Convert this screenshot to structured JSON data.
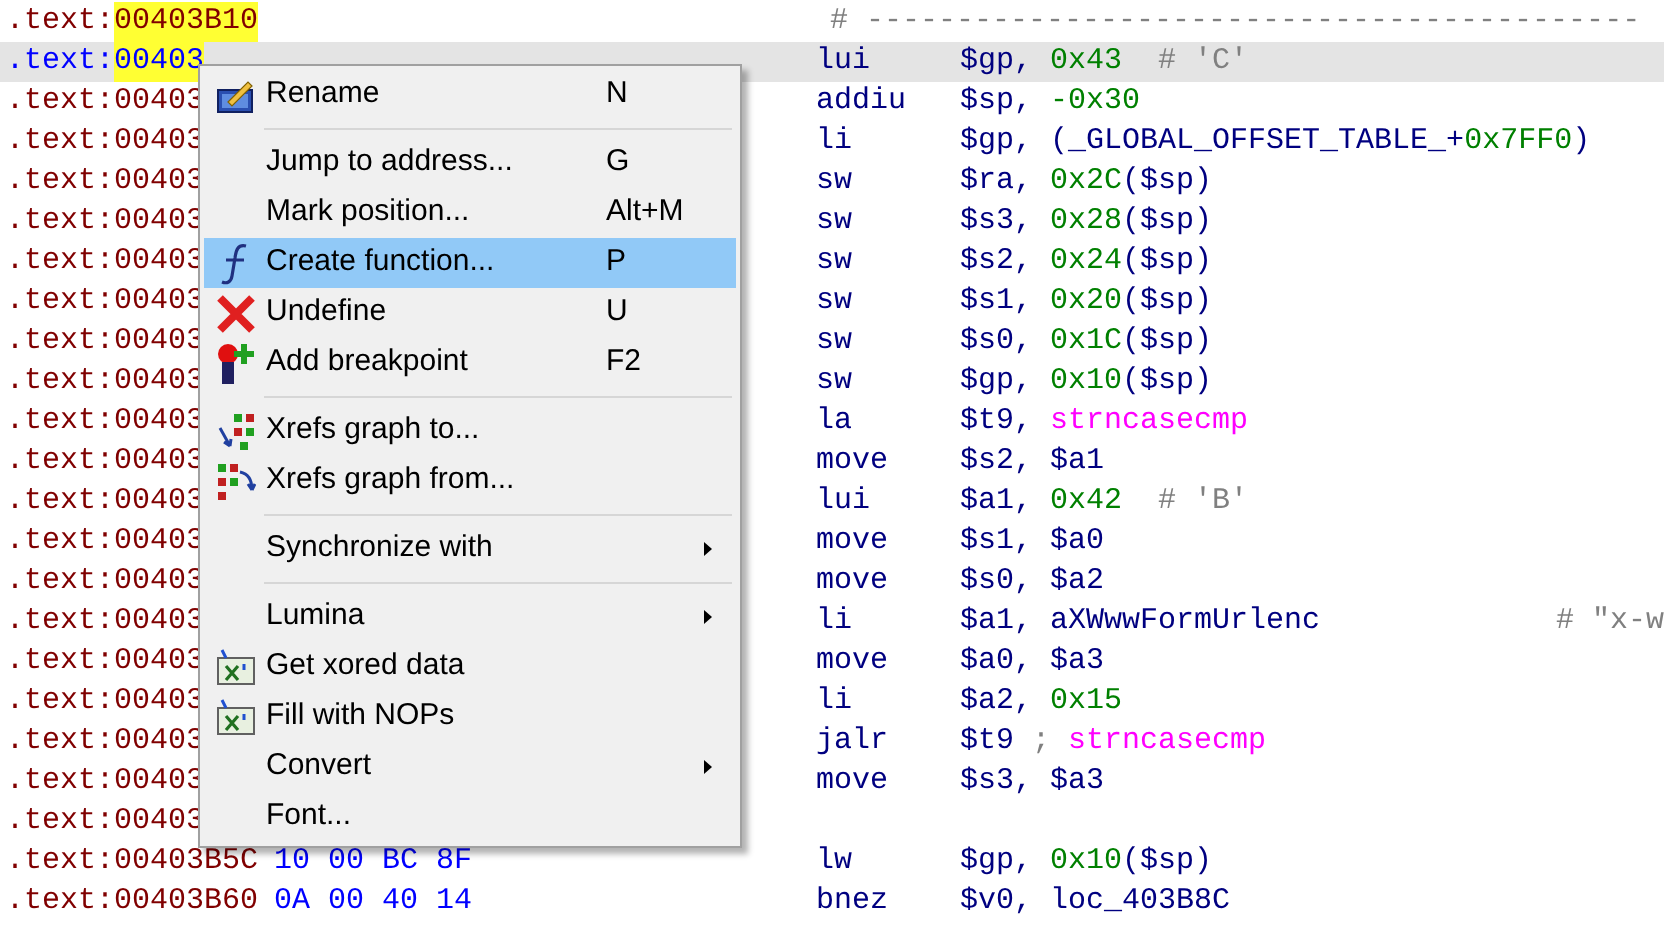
{
  "listing": {
    "rows": [
      {
        "segment": ".text:",
        "address": "00403B10",
        "highlighted": true,
        "selected": false,
        "tokens": [
          {
            "kind": "comment",
            "text": "# -------------------------------------------"
          }
        ]
      },
      {
        "segment": ".text:",
        "address": "00403",
        "highlighted": true,
        "selected": true,
        "mnemonic": "lui",
        "tokens": [
          {
            "kind": "reg",
            "text": "$gp,"
          },
          {
            "kind": "num",
            "text": "0x43"
          },
          {
            "kind": "comment",
            "text": " # 'C'"
          }
        ]
      },
      {
        "segment": ".text:",
        "address": "00403",
        "highlighted": false,
        "selected": false,
        "mnemonic": "addiu",
        "tokens": [
          {
            "kind": "reg",
            "text": "$sp,"
          },
          {
            "kind": "num",
            "text": "-0x30"
          }
        ]
      },
      {
        "segment": ".text:",
        "address": "00403",
        "highlighted": false,
        "selected": false,
        "mnemonic": "li",
        "tokens": [
          {
            "kind": "reg",
            "text": "$gp,"
          },
          {
            "kind": "reg",
            "text": "(_GLOBAL_OFFSET_TABLE_+"
          },
          {
            "kind": "num",
            "text": "0x7FF0"
          },
          {
            "kind": "punct",
            "text": ")"
          }
        ]
      },
      {
        "segment": ".text:",
        "address": "00403",
        "highlighted": false,
        "selected": false,
        "mnemonic": "sw",
        "tokens": [
          {
            "kind": "reg",
            "text": "$ra,"
          },
          {
            "kind": "num",
            "text": "0x2C"
          },
          {
            "kind": "punct",
            "text": "($sp)"
          }
        ]
      },
      {
        "segment": ".text:",
        "address": "00403",
        "highlighted": false,
        "selected": false,
        "mnemonic": "sw",
        "tokens": [
          {
            "kind": "reg",
            "text": "$s3,"
          },
          {
            "kind": "num",
            "text": "0x28"
          },
          {
            "kind": "punct",
            "text": "($sp)"
          }
        ]
      },
      {
        "segment": ".text:",
        "address": "00403",
        "highlighted": false,
        "selected": false,
        "mnemonic": "sw",
        "tokens": [
          {
            "kind": "reg",
            "text": "$s2,"
          },
          {
            "kind": "num",
            "text": "0x24"
          },
          {
            "kind": "punct",
            "text": "($sp)"
          }
        ]
      },
      {
        "segment": ".text:",
        "address": "00403",
        "highlighted": false,
        "selected": false,
        "mnemonic": "sw",
        "tokens": [
          {
            "kind": "reg",
            "text": "$s1,"
          },
          {
            "kind": "num",
            "text": "0x20"
          },
          {
            "kind": "punct",
            "text": "($sp)"
          }
        ]
      },
      {
        "segment": ".text:",
        "address": "00403",
        "highlighted": false,
        "selected": false,
        "mnemonic": "sw",
        "tokens": [
          {
            "kind": "reg",
            "text": "$s0,"
          },
          {
            "kind": "num",
            "text": "0x1C"
          },
          {
            "kind": "punct",
            "text": "($sp)"
          }
        ]
      },
      {
        "segment": ".text:",
        "address": "00403",
        "highlighted": false,
        "selected": false,
        "mnemonic": "sw",
        "tokens": [
          {
            "kind": "reg",
            "text": "$gp,"
          },
          {
            "kind": "num",
            "text": "0x10"
          },
          {
            "kind": "punct",
            "text": "($sp)"
          }
        ]
      },
      {
        "segment": ".text:",
        "address": "00403",
        "highlighted": false,
        "selected": false,
        "mnemonic": "la",
        "tokens": [
          {
            "kind": "reg",
            "text": "$t9,"
          },
          {
            "kind": "name",
            "text": "strncasecmp"
          }
        ]
      },
      {
        "segment": ".text:",
        "address": "00403",
        "highlighted": false,
        "selected": false,
        "mnemonic": "move",
        "tokens": [
          {
            "kind": "reg",
            "text": "$s2,"
          },
          {
            "kind": "reg",
            "text": "$a1"
          }
        ]
      },
      {
        "segment": ".text:",
        "address": "00403",
        "highlighted": false,
        "selected": false,
        "mnemonic": "lui",
        "tokens": [
          {
            "kind": "reg",
            "text": "$a1,"
          },
          {
            "kind": "num",
            "text": "0x42"
          },
          {
            "kind": "comment",
            "text": " # 'B'"
          }
        ]
      },
      {
        "segment": ".text:",
        "address": "00403",
        "highlighted": false,
        "selected": false,
        "mnemonic": "move",
        "tokens": [
          {
            "kind": "reg",
            "text": "$s1,"
          },
          {
            "kind": "reg",
            "text": "$a0"
          }
        ]
      },
      {
        "segment": ".text:",
        "address": "00403",
        "highlighted": false,
        "selected": false,
        "mnemonic": "move",
        "tokens": [
          {
            "kind": "reg",
            "text": "$s0,"
          },
          {
            "kind": "reg",
            "text": "$a2"
          }
        ]
      },
      {
        "segment": ".text:",
        "address": "00403",
        "highlighted": false,
        "selected": false,
        "mnemonic": "li",
        "tokens": [
          {
            "kind": "reg",
            "text": "$a1,"
          },
          {
            "kind": "reg",
            "text": "aXWwwFormUrlenc"
          },
          {
            "kind": "far_comment",
            "text": "# \"x-w"
          }
        ]
      },
      {
        "segment": ".text:",
        "address": "00403",
        "highlighted": false,
        "selected": false,
        "mnemonic": "move",
        "tokens": [
          {
            "kind": "reg",
            "text": "$a0,"
          },
          {
            "kind": "reg",
            "text": "$a3"
          }
        ]
      },
      {
        "segment": ".text:",
        "address": "00403",
        "highlighted": false,
        "selected": false,
        "mnemonic": "li",
        "tokens": [
          {
            "kind": "reg",
            "text": "$a2,"
          },
          {
            "kind": "num",
            "text": "0x15"
          }
        ]
      },
      {
        "segment": ".text:",
        "address": "00403",
        "highlighted": false,
        "selected": false,
        "mnemonic": "jalr",
        "tokens": [
          {
            "kind": "reg",
            "text": "$t9"
          },
          {
            "kind": "comment",
            "text": ";"
          },
          {
            "kind": "name",
            "text": "strncasecmp"
          }
        ]
      },
      {
        "segment": ".text:",
        "address": "00403",
        "highlighted": false,
        "selected": false,
        "mnemonic": "move",
        "tokens": [
          {
            "kind": "reg",
            "text": "$s3,"
          },
          {
            "kind": "reg",
            "text": "$a3"
          }
        ]
      },
      {
        "segment": ".text:",
        "address": "00403",
        "highlighted": false,
        "selected": false
      },
      {
        "segment": ".text:",
        "address": "00403B5C",
        "bytes": "10 00 BC 8F",
        "highlighted": false,
        "selected": false,
        "mnemonic": "lw",
        "tokens": [
          {
            "kind": "reg",
            "text": "$gp,"
          },
          {
            "kind": "num",
            "text": "0x10"
          },
          {
            "kind": "punct",
            "text": "($sp)"
          }
        ]
      },
      {
        "segment": ".text:",
        "address": "00403B60",
        "bytes": "0A 00 40 14",
        "highlighted": false,
        "selected": false,
        "mnemonic": "bnez",
        "tokens": [
          {
            "kind": "reg",
            "text": "$v0,"
          },
          {
            "kind": "reg",
            "text": "loc_403B8C"
          }
        ]
      }
    ]
  },
  "context_menu": {
    "items": [
      {
        "kind": "item",
        "label": "Rename",
        "shortcut": "N",
        "selected": false
      },
      {
        "kind": "separator"
      },
      {
        "kind": "item",
        "label": "Jump to address...",
        "shortcut": "G",
        "selected": false
      },
      {
        "kind": "item",
        "label": "Mark position...",
        "shortcut": "Alt+M",
        "selected": false
      },
      {
        "kind": "item",
        "label": "Create function...",
        "shortcut": "P",
        "selected": true
      },
      {
        "kind": "item",
        "label": "Undefine",
        "shortcut": "U",
        "selected": false
      },
      {
        "kind": "item",
        "label": "Add breakpoint",
        "shortcut": "F2",
        "selected": false
      },
      {
        "kind": "separator"
      },
      {
        "kind": "item",
        "label": "Xrefs graph to...",
        "selected": false
      },
      {
        "kind": "item",
        "label": "Xrefs graph from...",
        "selected": false
      },
      {
        "kind": "separator"
      },
      {
        "kind": "item",
        "label": "Synchronize with",
        "submenu": true,
        "selected": false
      },
      {
        "kind": "separator"
      },
      {
        "kind": "item",
        "label": "Lumina",
        "submenu": true,
        "selected": false
      },
      {
        "kind": "item",
        "label": "Get xored data",
        "selected": false
      },
      {
        "kind": "item",
        "label": "Fill with NOPs",
        "selected": false
      },
      {
        "kind": "item",
        "label": "Convert",
        "submenu": true,
        "selected": false
      },
      {
        "kind": "item",
        "label": "Font...",
        "selected": false
      }
    ]
  }
}
